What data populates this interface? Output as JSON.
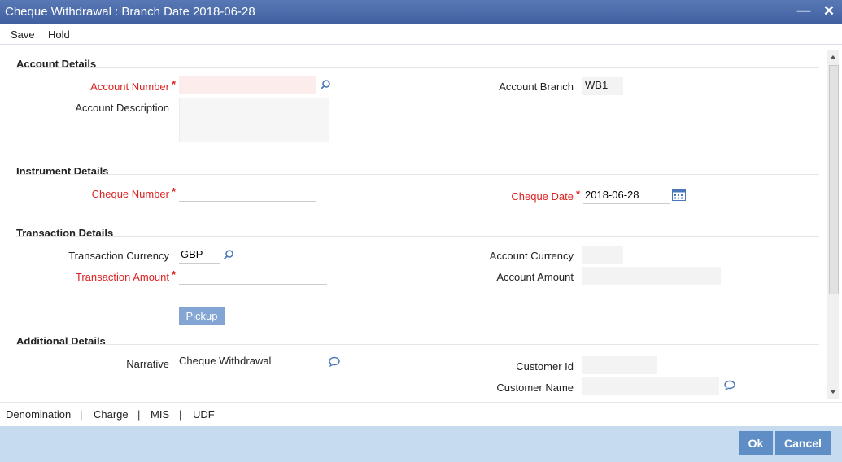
{
  "window": {
    "title": "Cheque Withdrawal : Branch Date 2018-06-28",
    "minimize_glyph": "—",
    "close_glyph": "✕"
  },
  "menu": {
    "save": "Save",
    "hold": "Hold"
  },
  "sections": {
    "account": "Account Details",
    "instrument": "Instrument Details",
    "transaction": "Transaction Details",
    "additional": "Additional Details"
  },
  "account": {
    "number_label": "Account Number",
    "number_value": "",
    "description_label": "Account Description",
    "description_value": "",
    "branch_label": "Account Branch",
    "branch_value": "WB1"
  },
  "instrument": {
    "cheque_number_label": "Cheque Number",
    "cheque_number_value": "",
    "cheque_date_label": "Cheque Date",
    "cheque_date_value": "2018-06-28"
  },
  "transaction": {
    "currency_label": "Transaction Currency",
    "currency_value": "GBP",
    "amount_label": "Transaction Amount",
    "amount_value": "",
    "account_currency_label": "Account Currency",
    "account_currency_value": "",
    "account_amount_label": "Account Amount",
    "account_amount_value": "",
    "pickup_label": "Pickup"
  },
  "additional": {
    "narrative_label": "Narrative",
    "narrative_value": "Cheque Withdrawal",
    "customer_id_label": "Customer Id",
    "customer_id_value": "",
    "customer_name_label": "Customer Name",
    "customer_name_value": ""
  },
  "required_marker": "*",
  "tabs": [
    "Denomination",
    "Charge",
    "MIS",
    "UDF"
  ],
  "tab_separator": "|",
  "footer": {
    "ok": "Ok",
    "cancel": "Cancel"
  },
  "colors": {
    "title_bar": "#4f6fae",
    "required": "#d22222",
    "footer_bg": "#c6dbef",
    "button": "#5f8ec6"
  },
  "icons": {
    "search": "search-icon",
    "calendar": "calendar-icon",
    "comment": "comment-icon"
  }
}
